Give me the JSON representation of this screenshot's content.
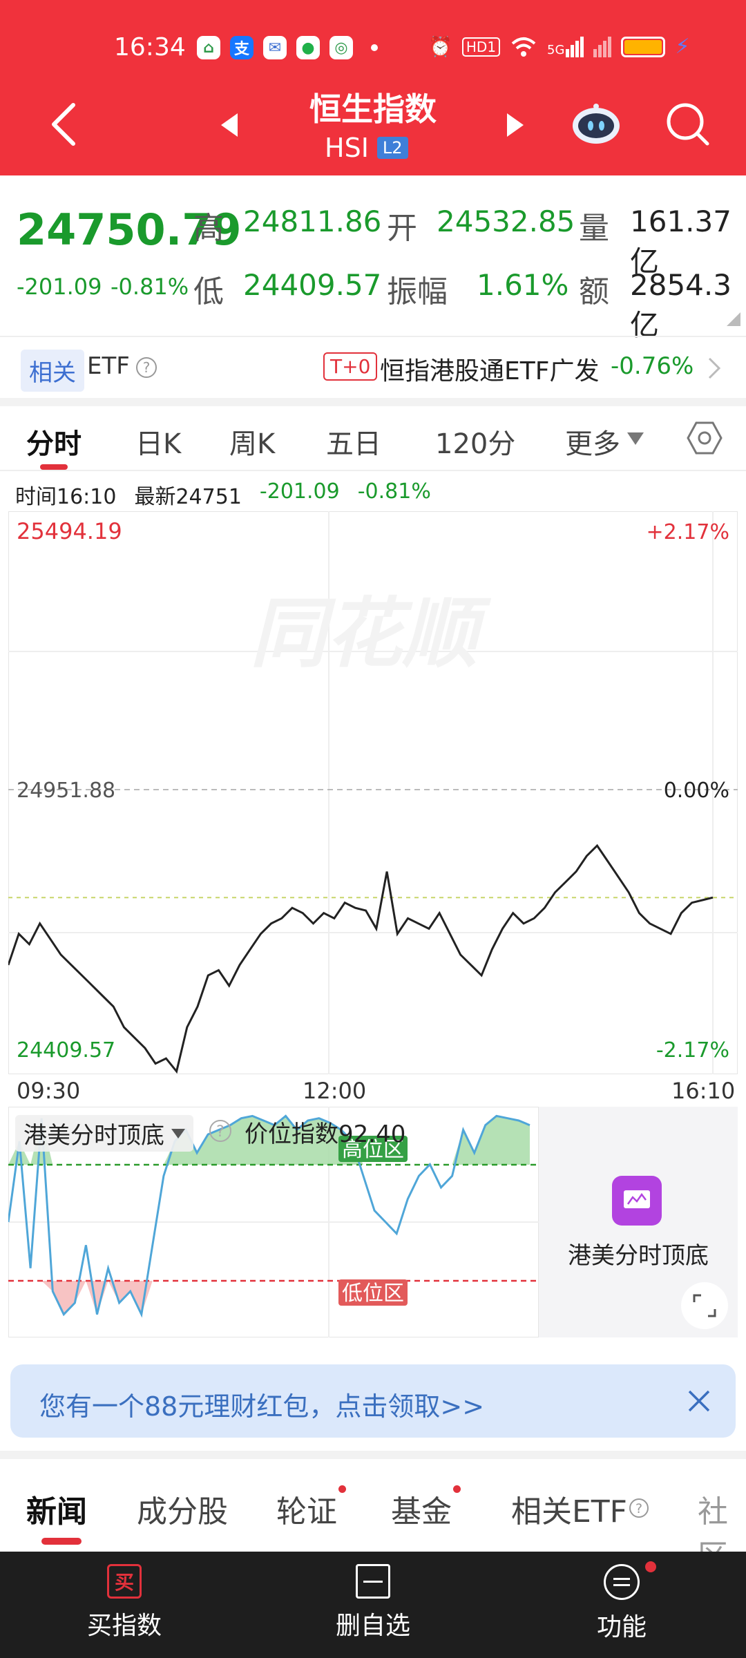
{
  "status_bar": {
    "time": "16:34",
    "icons": [
      "home-app-icon",
      "alipay-icon",
      "app-icon",
      "wechat-icon",
      "leaf-app-icon",
      "dot-icon",
      "alarm-icon",
      "hd-icon",
      "wifi-icon",
      "signal-5g-icon",
      "signal-icon",
      "battery-icon",
      "charging-icon"
    ],
    "hd_label": "HD1",
    "net_label": "5G"
  },
  "header": {
    "title": "恒生指数",
    "code": "HSI",
    "level_badge": "L2",
    "colors": {
      "background": "#f0323c"
    }
  },
  "quote": {
    "last": "24750.79",
    "change": "-201.09",
    "change_pct": "-0.81%",
    "high_label": "高",
    "high": "24811.86",
    "open_label": "开",
    "open": "24532.85",
    "volume_label": "量",
    "volume": "161.37亿",
    "low_label": "低",
    "low": "24409.57",
    "amplitude_label": "振幅",
    "amplitude": "1.61%",
    "amount_label": "额",
    "amount": "2854.3亿"
  },
  "etf_row": {
    "tag": "相关",
    "etf_label": "ETF",
    "t0": "T+0",
    "name": "恒指港股通ETF广发",
    "change": "-0.76%"
  },
  "chart_tabs": [
    "分时",
    "日K",
    "周K",
    "五日",
    "120分",
    "更多"
  ],
  "chart_info": {
    "time": "时间16:10",
    "latest": "最新24751",
    "change": "-201.09",
    "change_pct": "-0.81%"
  },
  "chart_data": {
    "type": "line",
    "ylim": [
      24409.57,
      25494.19
    ],
    "top_label": "25494.19",
    "top_pct": "+2.17%",
    "ref_label": "24951.88",
    "ref_pct": "0.00%",
    "bottom_label": "24409.57",
    "bottom_pct": "-2.17%",
    "x_ticks": [
      "09:30",
      "12:00",
      "16:10"
    ],
    "reference": 24951.88,
    "average": 24750,
    "series": [
      {
        "values": [
          24620,
          24680,
          24660,
          24700,
          24670,
          24640,
          24620,
          24600,
          24580,
          24560,
          24540,
          24500,
          24480,
          24460,
          24430,
          24440,
          24415,
          24500,
          24540,
          24600,
          24610,
          24580,
          24620,
          24650,
          24680,
          24700,
          24710,
          24730,
          24720,
          24700,
          24720,
          24710,
          24740,
          24730,
          24725,
          24690,
          24800,
          24680,
          24710,
          24700,
          24690,
          24720,
          24680,
          24640,
          24620,
          24600,
          24650,
          24690,
          24720,
          24700,
          24710,
          24730,
          24760,
          24780,
          24800,
          24830,
          24850,
          24820,
          24790,
          24760,
          24720,
          24700,
          24690,
          24680,
          24720,
          24740,
          24745,
          24750
        ]
      }
    ]
  },
  "indicator": {
    "name": "港美分时顶底",
    "index_label": "价位指数92.40",
    "high_zone": "高位区",
    "low_zone": "低位区",
    "side_title": "港美分时顶底",
    "values": [
      50,
      85,
      30,
      95,
      20,
      10,
      15,
      40,
      10,
      30,
      15,
      20,
      10,
      40,
      70,
      85,
      90,
      80,
      88,
      90,
      92,
      95,
      96,
      94,
      92,
      96,
      90,
      94,
      95,
      93,
      90,
      85,
      70,
      55,
      50,
      45,
      60,
      70,
      75,
      65,
      70,
      90,
      80,
      92,
      96,
      95,
      94,
      92
    ]
  },
  "banner": {
    "text": "您有一个88元理财红包，点击领取>>"
  },
  "news_tabs": [
    "新闻",
    "成分股",
    "轮证",
    "基金",
    "相关ETF",
    "社区"
  ],
  "bottom_nav": {
    "buy_icon_text": "买",
    "buy": "买指数",
    "remove": "删自选",
    "func": "功能"
  }
}
